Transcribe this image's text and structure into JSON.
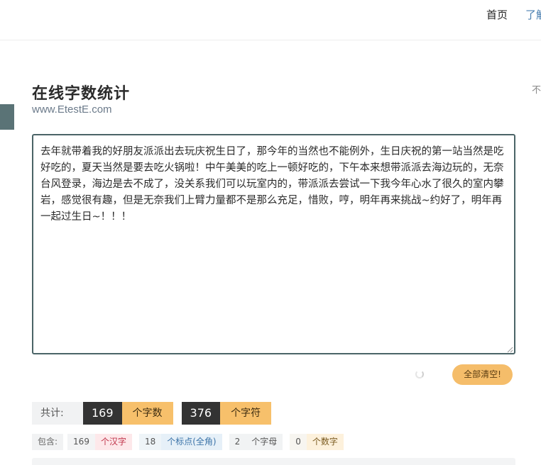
{
  "nav": {
    "home": "首页",
    "about": "了解"
  },
  "right_hint": "不",
  "header": {
    "title": "在线字数统计",
    "subtitle": "www.EtestE.com"
  },
  "editor": {
    "value": "去年就带着我的好朋友派派出去玩庆祝生日了，那今年的当然也不能例外，生日庆祝的第一站当然是吃好吃的，夏天当然是要去吃火锅啦！中午美美的吃上一顿好吃的，下午本来想带派派去海边玩的，无奈台风登录，海边是去不成了，没关系我们可以玩室内的，带派派去尝试一下我今年心水了很久的室内攀岩，感觉很有趣，但是无奈我们上臂力量都不是那么充足，惜败，哼，明年再来挑战~约好了，明年再一起过生日~！！！"
  },
  "actions": {
    "clear_label": "全部清空!"
  },
  "totals": {
    "label": "共计:",
    "chars_count": "169",
    "chars_unit": "个字数",
    "symbols_count": "376",
    "symbols_unit": "个字符"
  },
  "contains": {
    "label": "包含:",
    "han_count": "169",
    "han_unit": "个汉字",
    "punct_count": "18",
    "punct_unit": "个标点(全角)",
    "letter_count": "2",
    "letter_unit": "个字母",
    "digit_count": "0",
    "digit_unit": "个数字"
  },
  "colors": {
    "accent_teal": "#4b6467",
    "clear_button": "#f5bd6a",
    "count_dark": "#333333",
    "count_unit": "#f7c06b"
  }
}
